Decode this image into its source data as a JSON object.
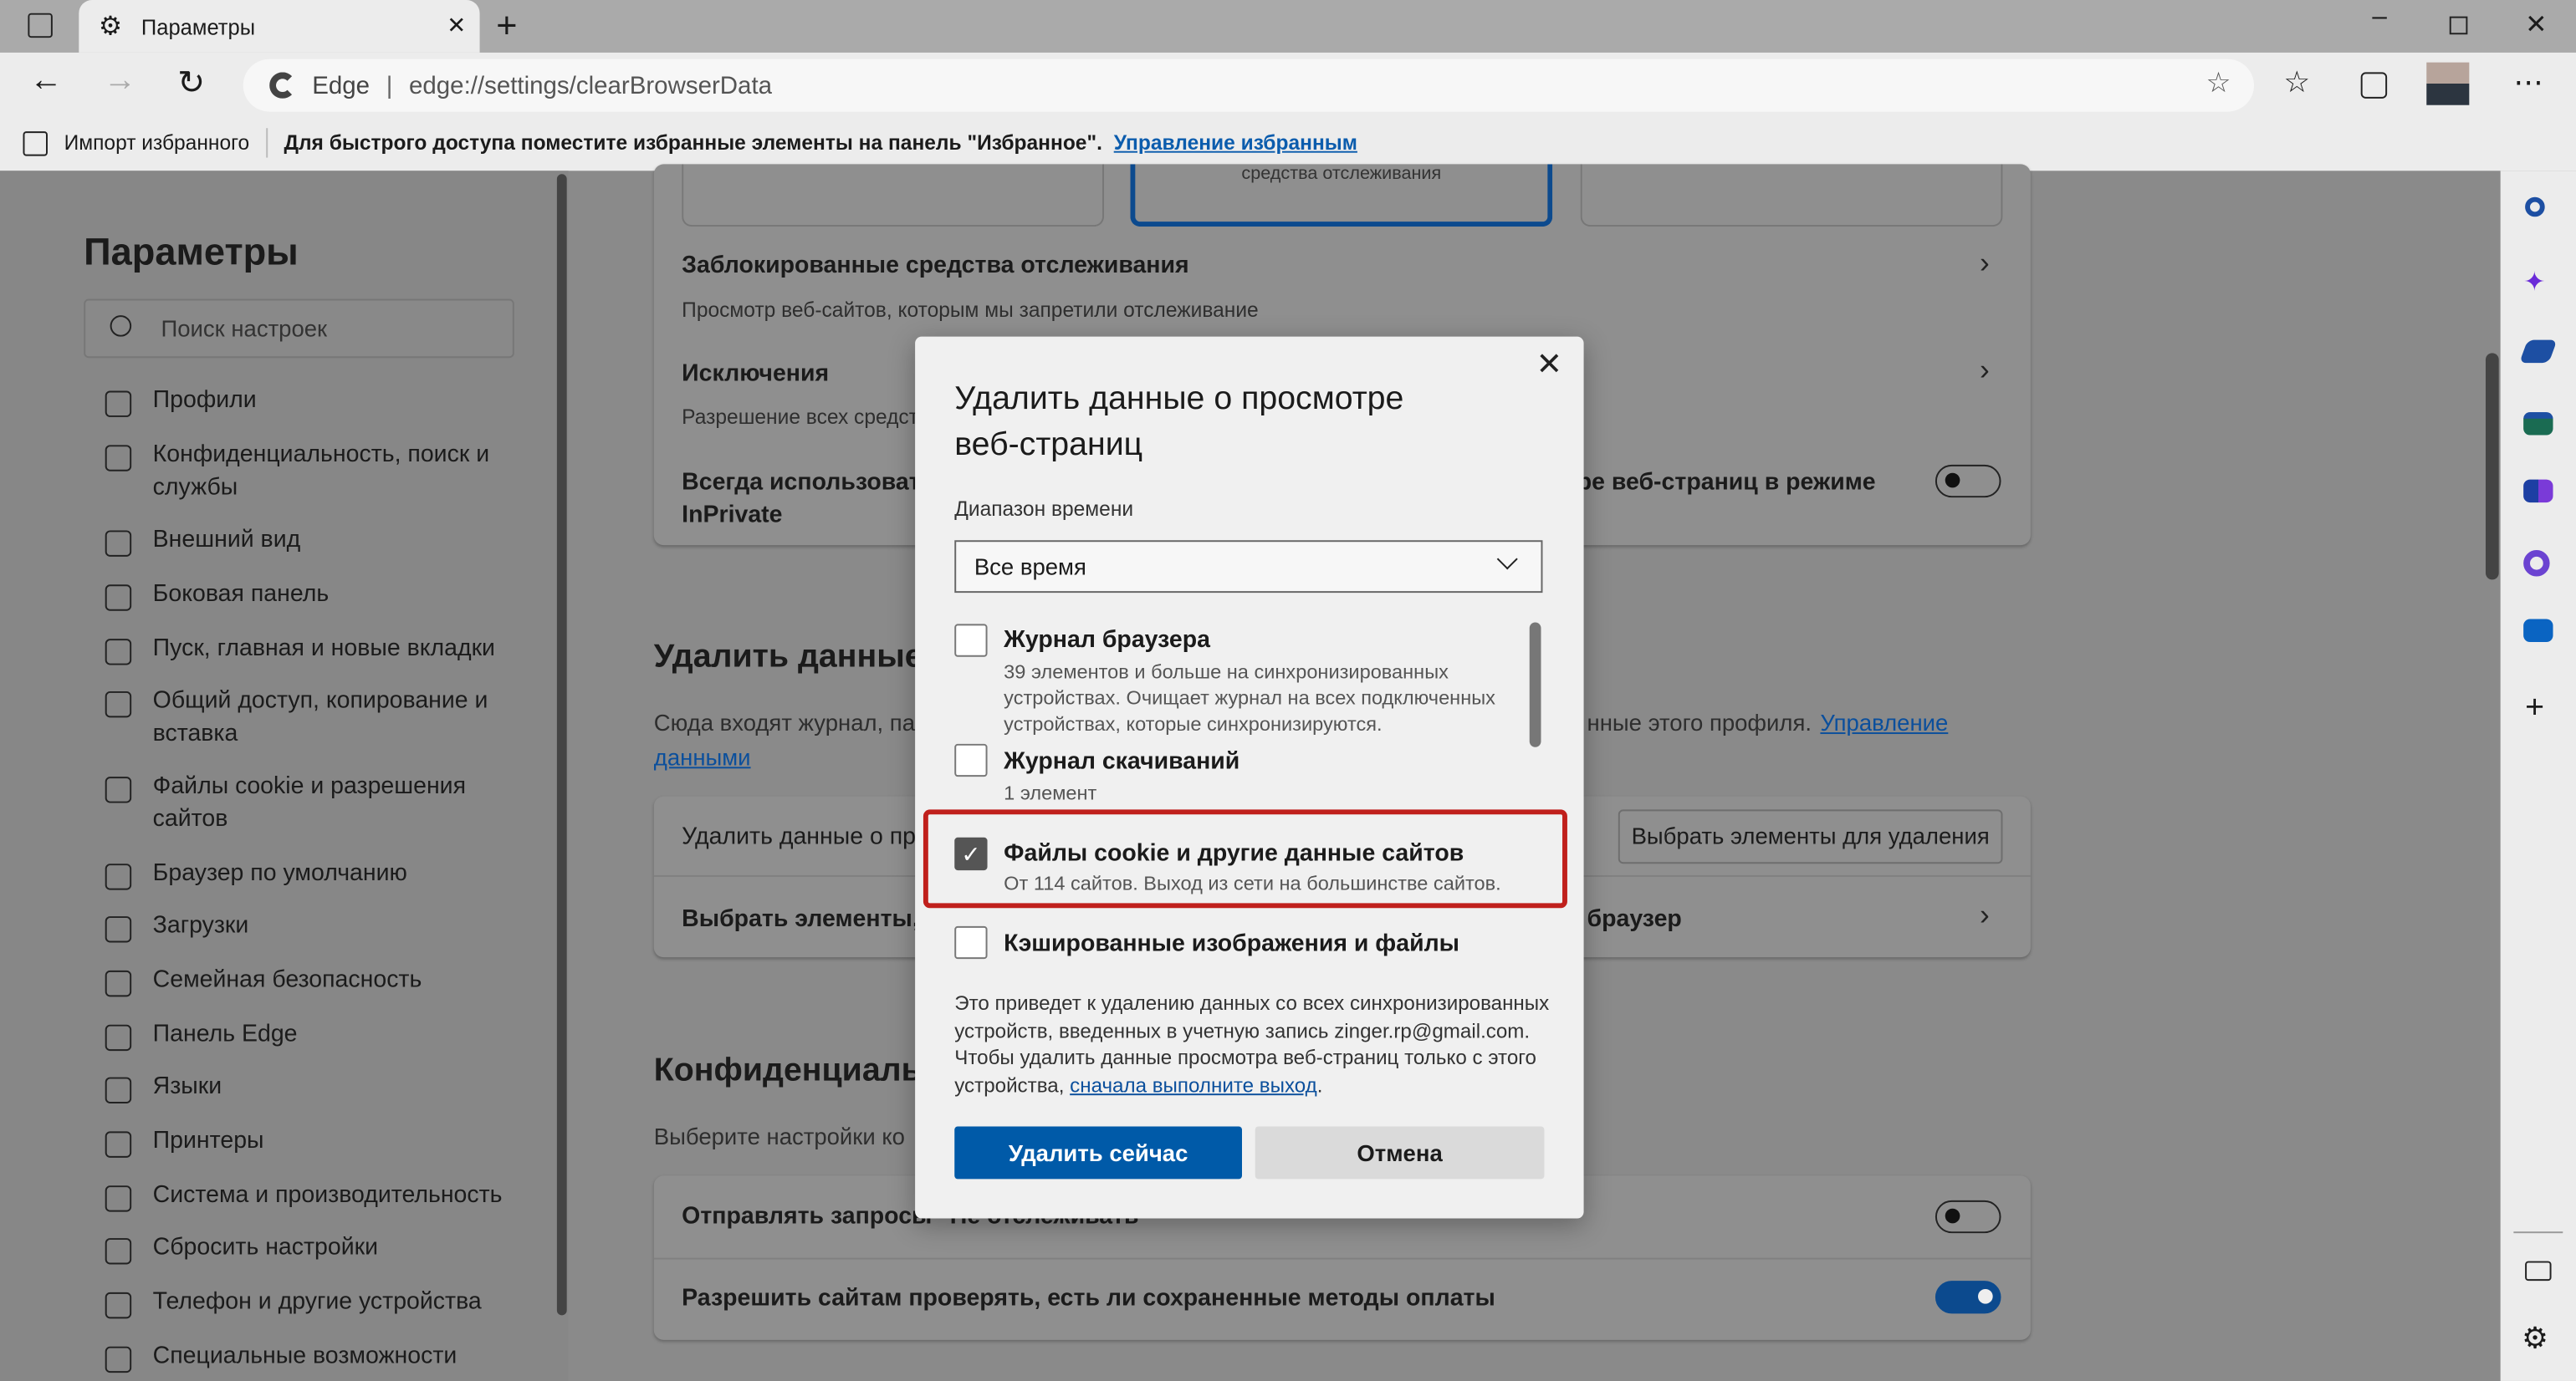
{
  "browser": {
    "tab_title": "Параметры",
    "address_brand": "Edge",
    "url": "edge://settings/clearBrowserData",
    "favorites_bar": {
      "import_label": "Импорт избранного",
      "hint": "Для быстрого доступа поместите избранные элементы на панель \"Избранное\".",
      "manage_link": "Управление избранным"
    }
  },
  "sidebar": {
    "title": "Параметры",
    "search_placeholder": "Поиск настроек",
    "items": [
      {
        "label": "Профили"
      },
      {
        "label": "Конфиденциальность, поиск и службы"
      },
      {
        "label": "Внешний вид"
      },
      {
        "label": "Боковая панель"
      },
      {
        "label": "Пуск, главная и новые вкладки"
      },
      {
        "label": "Общий доступ, копирование и вставка"
      },
      {
        "label": "Файлы cookie и разрешения сайтов"
      },
      {
        "label": "Браузер по умолчанию"
      },
      {
        "label": "Загрузки"
      },
      {
        "label": "Семейная безопасность"
      },
      {
        "label": "Панель Edge"
      },
      {
        "label": "Языки"
      },
      {
        "label": "Принтеры"
      },
      {
        "label": "Система и производительность"
      },
      {
        "label": "Сбросить настройки"
      },
      {
        "label": "Телефон и другие устройства"
      },
      {
        "label": "Специальные возможности"
      }
    ]
  },
  "main": {
    "tracking_card_partial": "средства отслеживания",
    "blocked_trackers": {
      "title": "Заблокированные средства отслеживания",
      "desc": "Просмотр веб-сайтов, которым мы запретили отслеживание"
    },
    "exceptions": {
      "title": "Исключения",
      "desc": "Разрешение всех средств"
    },
    "always_strict": {
      "title_left": "Всегда использовать",
      "title_right": "ре веб-страниц в режиме",
      "title_line2": "InPrivate",
      "enabled": false
    },
    "clear_section": {
      "title": "Удалить данные",
      "desc_left": "Сюда входят журнал, па",
      "desc_right": "нные этого профиля.",
      "manage_link_1": "Управление",
      "manage_link_2": "данными",
      "row1_label": "Удалить данные о пр",
      "row1_button": "Выбрать элементы для удаления",
      "row2_label": "Выбрать элементы, к",
      "row2_right": "браузер"
    },
    "privacy_section": {
      "title": "Конфиденциаль",
      "desc": "Выберите настройки ко",
      "dnt_label": "Отправлять запросы \"Не отслеживать\"",
      "dnt_enabled": false,
      "payment_label": "Разрешить сайтам проверять, есть ли сохраненные методы оплаты",
      "payment_enabled": true
    }
  },
  "dialog": {
    "title_line1": "Удалить данные о просмотре",
    "title_line2": "веб-страниц",
    "range_label": "Диапазон времени",
    "range_value": "Все время",
    "options": [
      {
        "label": "Журнал браузера",
        "desc": "39 элементов и больше на синхронизированных устройствах. Очищает журнал на всех подключенных устройствах, которые синхронизируются.",
        "checked": false
      },
      {
        "label": "Журнал скачиваний",
        "desc": "1 элемент",
        "checked": false
      },
      {
        "label": "Файлы cookie и другие данные сайтов",
        "desc": "От 114 сайтов. Выход из сети на большинстве сайтов.",
        "checked": true
      },
      {
        "label": "Кэшированные изображения и файлы",
        "checked": false
      }
    ],
    "notice": "Это приведет к удалению данных со всех синхронизированных устройств, введенных в учетную запись zinger.rp@gmail.com. Чтобы удалить данные просмотра веб-страниц только с этого устройства,",
    "notice_link": "сначала выполните выход",
    "notice_end": ".",
    "primary_button": "Удалить сейчас",
    "cancel_button": "Отмена",
    "check_mark": "✓"
  },
  "colors": {
    "accent": "#005fb8",
    "highlight": "#c0201c",
    "overlay": "#8a8a8a"
  }
}
